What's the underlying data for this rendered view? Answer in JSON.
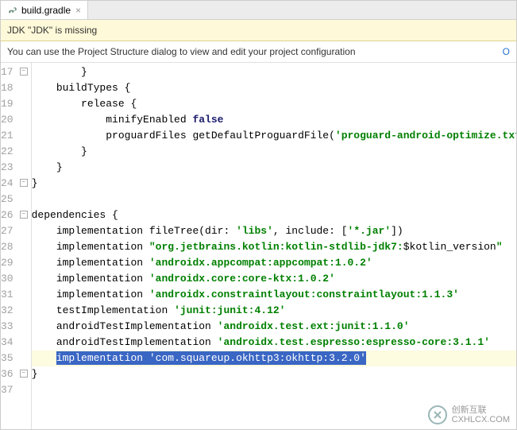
{
  "tab": {
    "label": "build.gradle",
    "close": "×"
  },
  "warning": "JDK \"JDK\" is missing",
  "hint": "You can use the Project Structure dialog to view and edit your project configuration",
  "hint_action": "O",
  "lines": {
    "l17": {
      "num": "17"
    },
    "l18": {
      "num": "18",
      "text": "buildTypes {"
    },
    "l19": {
      "num": "19",
      "text": "release {"
    },
    "l20": {
      "num": "20",
      "a": "minifyEnabled ",
      "b": "false"
    },
    "l21": {
      "num": "21",
      "a": "proguardFiles getDefaultProguardFile(",
      "b": "'proguard-android-optimize.txt'",
      "c": "),"
    },
    "l22": {
      "num": "22"
    },
    "l23": {
      "num": "23"
    },
    "l24": {
      "num": "24"
    },
    "l25": {
      "num": "25"
    },
    "l26": {
      "num": "26",
      "text": "dependencies {"
    },
    "l27": {
      "num": "27",
      "a": "implementation fileTree(dir: ",
      "b": "'libs'",
      "c": ", include: [",
      "d": "'*.jar'",
      "e": "])"
    },
    "l28": {
      "num": "28",
      "a": "implementation ",
      "b": "\"org.jetbrains.kotlin:kotlin-stdlib-jdk7:",
      "c": "$kotlin_version",
      "d": "\""
    },
    "l29": {
      "num": "29",
      "a": "implementation ",
      "b": "'androidx.appcompat:appcompat:1.0.2'"
    },
    "l30": {
      "num": "30",
      "a": "implementation ",
      "b": "'androidx.core:core-ktx:1.0.2'"
    },
    "l31": {
      "num": "31",
      "a": "implementation ",
      "b": "'androidx.constraintlayout:constraintlayout:1.1.3'"
    },
    "l32": {
      "num": "32",
      "a": "testImplementation ",
      "b": "'junit:junit:4.12'"
    },
    "l33": {
      "num": "33",
      "a": "androidTestImplementation ",
      "b": "'androidx.test.ext:junit:1.1.0'"
    },
    "l34": {
      "num": "34",
      "a": "androidTestImplementation ",
      "b": "'androidx.test.espresso:espresso-core:3.1.1'"
    },
    "l35": {
      "num": "35",
      "a": "implementation ",
      "b": "'com.squareup.okhttp3:okhttp:3.2.0'"
    },
    "l36": {
      "num": "36"
    },
    "l37": {
      "num": "37"
    }
  },
  "watermark": {
    "line1": "创新互联",
    "line2": "CXHLCX.COM"
  }
}
